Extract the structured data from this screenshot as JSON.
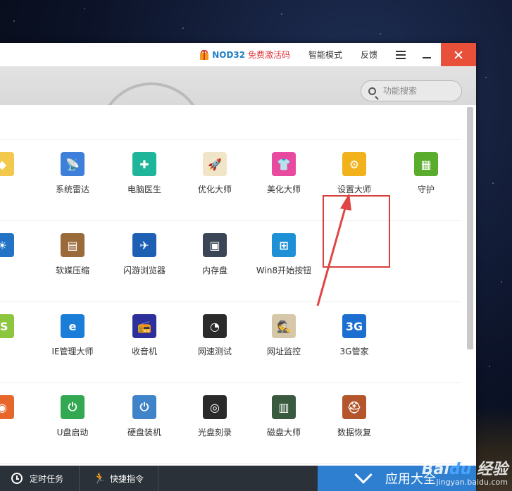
{
  "titlebar": {
    "promo_brand": "NOD32",
    "promo_text": "免费激活码",
    "mode_label": "智能模式",
    "feedback_label": "反馈"
  },
  "search": {
    "placeholder": "功能搜索"
  },
  "rows": [
    [
      {
        "label": "件管家",
        "icon": "software-manager-icon",
        "color": "#f2c94c"
      },
      {
        "label": "系统雷达",
        "icon": "radar-dish-icon",
        "color": "#3d7fd9"
      },
      {
        "label": "电脑医生",
        "icon": "first-aid-kit-icon",
        "color": "#1fb59a"
      },
      {
        "label": "优化大师",
        "icon": "rocket-icon",
        "color": "#f1e5c8"
      },
      {
        "label": "美化大师",
        "icon": "tshirt-icon",
        "color": "#e84aa0"
      },
      {
        "label": "设置大师",
        "icon": "gear-icon",
        "color": "#f2b21c"
      },
      {
        "label": "守护",
        "icon": "shield-icon",
        "color": "#5aac2c"
      }
    ],
    [
      {
        "label": "屏时间",
        "icon": "weather-clock-icon",
        "color": "#2273c6"
      },
      {
        "label": "软媒压缩",
        "icon": "archive-books-icon",
        "color": "#9a6a3a"
      },
      {
        "label": "闪游浏览器",
        "icon": "flash-browser-icon",
        "color": "#1d5fb3"
      },
      {
        "label": "内存盘",
        "icon": "memory-chip-icon",
        "color": "#3a4556"
      },
      {
        "label": "Win8开始按钮",
        "icon": "windows-logo-icon",
        "color": "#1e90d6"
      }
    ],
    [
      {
        "label": "S助手",
        "icon": "ios-helper-icon",
        "color": "#8cc63f"
      },
      {
        "label": "IE管理大师",
        "icon": "ie-logo-icon",
        "color": "#1a7ed8"
      },
      {
        "label": "收音机",
        "icon": "radio-icon",
        "color": "#2d2f9a"
      },
      {
        "label": "网速测试",
        "icon": "speedometer-icon",
        "color": "#2b2b2b"
      },
      {
        "label": "网址监控",
        "icon": "spy-hat-icon",
        "color": "#d6c7a8"
      },
      {
        "label": "3G管家",
        "icon": "3g-badge-icon",
        "color": "#1c6fd1"
      }
    ],
    [
      {
        "label": "以光驱",
        "icon": "optical-drive-icon",
        "color": "#e6662c"
      },
      {
        "label": "U盘启动",
        "icon": "usb-power-icon",
        "color": "#33a852"
      },
      {
        "label": "硬盘装机",
        "icon": "hard-disk-install-icon",
        "color": "#3f83c9"
      },
      {
        "label": "光盘刻录",
        "icon": "burn-disc-icon",
        "color": "#2a2a2a"
      },
      {
        "label": "磁盘大师",
        "icon": "disk-master-icon",
        "color": "#3a5a40"
      },
      {
        "label": "数据恢复",
        "icon": "data-recovery-icon",
        "color": "#b4552b"
      }
    ]
  ],
  "bottombar": {
    "schedule_label": "定时任务",
    "quick_label": "快捷指令",
    "all_apps_label": "应用大全"
  },
  "watermark": {
    "logo": "Baidu 经验",
    "url": "jingyan.baidu.com"
  },
  "colors": {
    "accent": "#2f7fd0",
    "close": "#e8503a",
    "highlight": "#d83f3b"
  }
}
